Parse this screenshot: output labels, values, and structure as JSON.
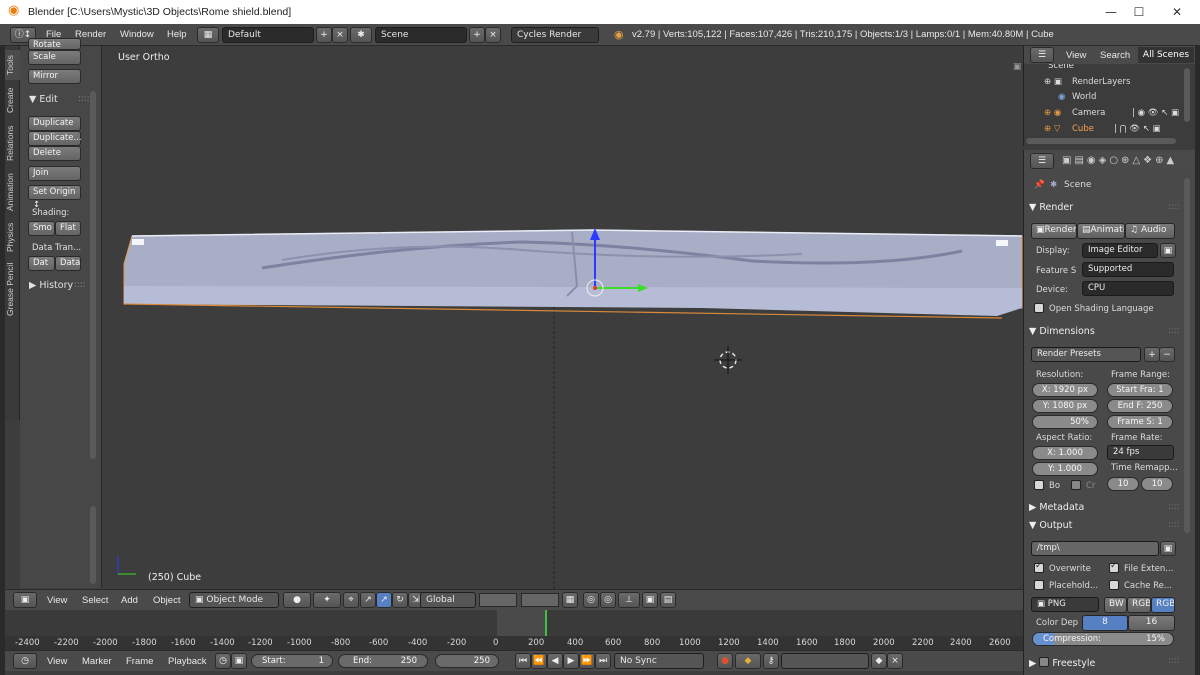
{
  "window": {
    "title": "Blender [C:\\Users\\Mystic\\3D Objects\\Rome shield.blend]"
  },
  "info": {
    "menus": [
      "File",
      "Render",
      "Window",
      "Help"
    ],
    "layout": "Default",
    "scene": "Scene",
    "engine": "Cycles Render",
    "stats": "v2.79 | Verts:105,122 | Faces:107,426 | Tris:210,175 | Objects:1/3 | Lamps:0/1 | Mem:40.80M | Cube"
  },
  "tabs": [
    "Tools",
    "Create",
    "Relations",
    "Animation",
    "Physics",
    "Grease Pencil"
  ],
  "tools": {
    "cut_label": "Rotate",
    "scale": "Scale",
    "mirror": "Mirror",
    "edit_header": "Edit",
    "duplicate": "Duplicate",
    "duplicate_linked": "Duplicate...",
    "delete": "Delete",
    "join": "Join",
    "set_origin": "Set Origin",
    "shading_label": "Shading:",
    "smooth": "Smo",
    "flat": "Flat",
    "data_transfer_label": "Data Tran...",
    "dat": "Dat",
    "data": "Data",
    "history": "History"
  },
  "viewport": {
    "view_label": "User Ortho",
    "object_label": "(250) Cube"
  },
  "viewport_header": {
    "view": "View",
    "select": "Select",
    "add": "Add",
    "object": "Object",
    "mode": "Object Mode",
    "orientation": "Global"
  },
  "timeline": {
    "ticks": [
      "-2400",
      "-2200",
      "-2000",
      "-1800",
      "-1600",
      "-1400",
      "-1200",
      "-1000",
      "-800",
      "-600",
      "-400",
      "-200",
      "0",
      "200",
      "400",
      "600",
      "800",
      "1000",
      "1200",
      "1400",
      "1600",
      "1800",
      "2000",
      "2200",
      "2400",
      "2600"
    ],
    "view": "View",
    "marker": "Marker",
    "frame": "Frame",
    "playback": "Playback",
    "start": "Start:",
    "start_val": "1",
    "end": "End:",
    "end_val": "250",
    "current": "250",
    "sync": "No Sync"
  },
  "outliner": {
    "view": "View",
    "search": "Search",
    "filter": "All Scenes",
    "items": [
      "Scene",
      "RenderLayers",
      "World",
      "Camera",
      "Cube"
    ]
  },
  "props": {
    "scene_label": "Scene",
    "render_header": "Render",
    "render_btn": "Render",
    "anim_btn": "Animati",
    "audio_btn": "Audio",
    "display_label": "Display:",
    "display_val": "Image Editor",
    "feature_label": "Feature S",
    "feature_val": "Supported",
    "device_label": "Device:",
    "device_val": "CPU",
    "osl": "Open Shading Language",
    "dimensions_header": "Dimensions",
    "presets": "Render Presets",
    "resolution_label": "Resolution:",
    "res_x": "X: 1920 px",
    "res_y": "Y: 1080 px",
    "res_pct": "50%",
    "frame_range_label": "Frame Range:",
    "start_frame": "Start Fra: 1",
    "end_frame": "End F: 250",
    "frame_step": "Frame S: 1",
    "aspect_label": "Aspect Ratio:",
    "asp_x": "X:     1.000",
    "asp_y": "Y:     1.000",
    "frame_rate_label": "Frame Rate:",
    "fps": "24 fps",
    "remap_label": "Time Remapp...",
    "remap_old": "10",
    "remap_new": "10",
    "border": "Bo",
    "crop": "Cr",
    "metadata_header": "Metadata",
    "output_header": "Output",
    "path": "/tmp\\",
    "overwrite": "Overwrite",
    "file_ext": "File Exten...",
    "placeholders": "Placehold...",
    "cache": "Cache Re...",
    "format": "PNG",
    "bw": "BW",
    "rgb": "RGB",
    "rgba": "RGB",
    "color_depth_label": "Color Dep",
    "depth8": "8",
    "depth16": "16",
    "compression": "Compression:",
    "compression_val": "15%",
    "freestyle_header": "Freestyle"
  }
}
